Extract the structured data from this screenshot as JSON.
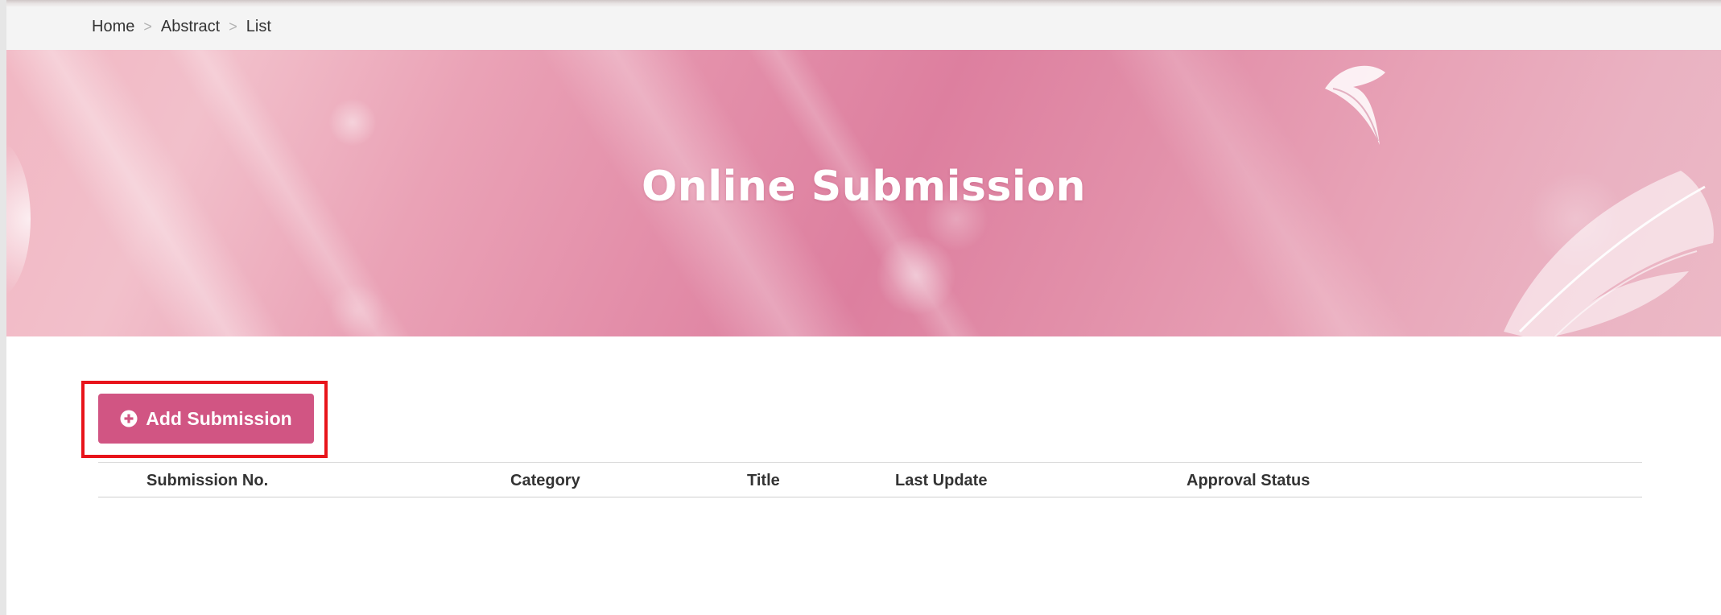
{
  "breadcrumb": {
    "items": [
      "Home",
      "Abstract",
      "List"
    ],
    "separator": ">"
  },
  "hero": {
    "title": "Online Submission"
  },
  "actions": {
    "add_submission_label": "Add Submission",
    "add_icon": "plus-circle-icon"
  },
  "table": {
    "columns": [
      "Submission No.",
      "Category",
      "Title",
      "Last Update",
      "Approval Status"
    ],
    "rows": []
  },
  "colors": {
    "button": "#d15583",
    "highlight": "#e8141b",
    "banner_pink": "#e38ea9"
  }
}
